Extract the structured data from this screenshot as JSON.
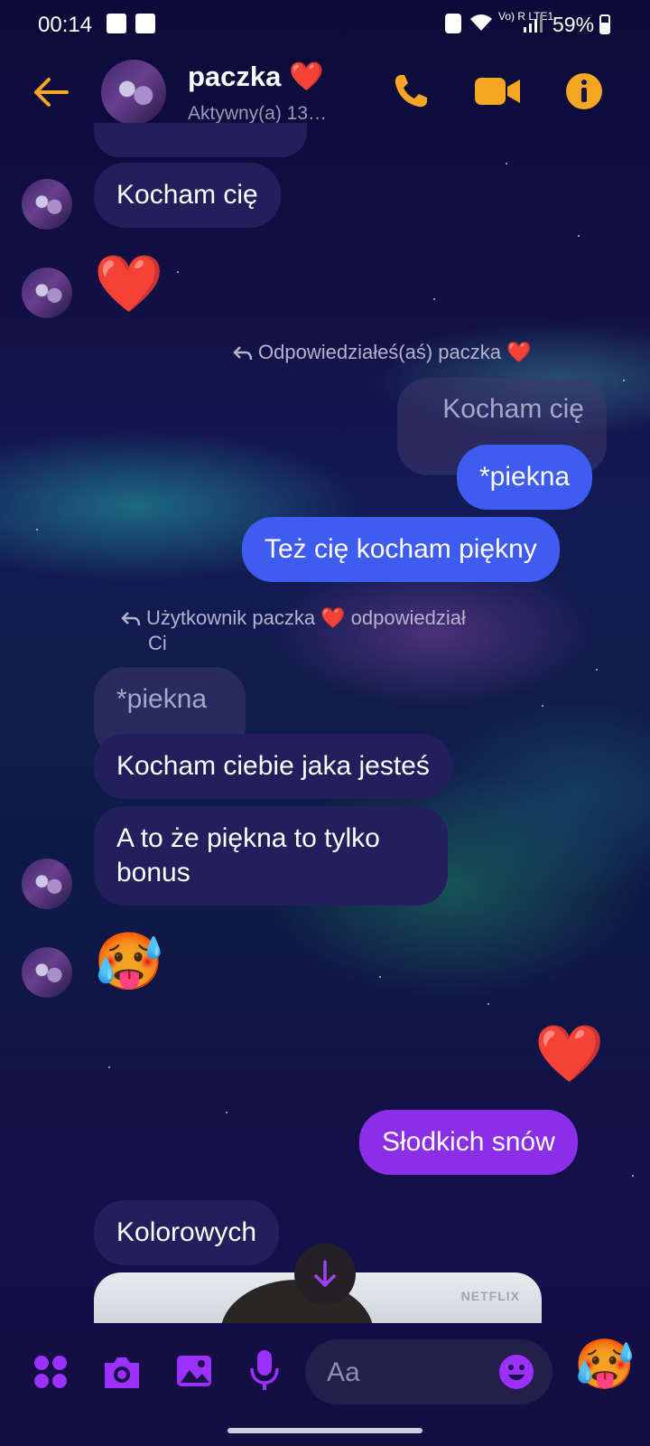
{
  "status_bar": {
    "time": "00:14",
    "battery": "59%",
    "battery_level": 0.59,
    "network": "Vo) R LTE1"
  },
  "header": {
    "name": "paczka",
    "name_emoji": "❤️",
    "status": "Aktywny(a) 13…",
    "icons": [
      "back-arrow-icon",
      "phone-icon",
      "video-camera-icon",
      "info-icon"
    ],
    "accent_color": "#f5a623"
  },
  "messages": [
    {
      "id": "m1",
      "side": "in",
      "text": "Kocham cię"
    },
    {
      "id": "m2",
      "side": "in",
      "type": "emoji",
      "text": "❤️"
    },
    {
      "id": "r1",
      "type": "reply_label",
      "text": "Odpowiedziałeś(aś) paczka ❤️"
    },
    {
      "id": "q1",
      "type": "reply_quote",
      "text": "Kocham cię"
    },
    {
      "id": "m3",
      "side": "out",
      "text": "*piekna"
    },
    {
      "id": "m4",
      "side": "out",
      "text": "Też cię kocham piękny"
    },
    {
      "id": "r2",
      "type": "reply_label",
      "line1": "Użytkownik paczka ❤️ odpowiedział",
      "line2": "Ci"
    },
    {
      "id": "q2",
      "type": "reply_quote",
      "text": "*piekna"
    },
    {
      "id": "m5",
      "side": "in",
      "text": "Kocham ciebie jaka jesteś"
    },
    {
      "id": "m6",
      "side": "in",
      "line1": "A to że piękna to tylko",
      "line2": "bonus"
    },
    {
      "id": "m7",
      "side": "in",
      "type": "emoji",
      "text": "🥵"
    },
    {
      "id": "m8",
      "side": "out",
      "type": "emoji",
      "text": "❤️"
    },
    {
      "id": "m9",
      "side": "out",
      "text": "Słodkich snów"
    },
    {
      "id": "m10",
      "side": "in",
      "text": "Kolorowych"
    }
  ],
  "shared_card": {
    "brand": "NETFLIX"
  },
  "composer": {
    "placeholder": "Aa",
    "quick_reaction": "🥵",
    "icons": [
      "menu-dots-icon",
      "camera-icon",
      "gallery-icon",
      "microphone-icon",
      "emoji-icon"
    ],
    "icon_color": "#9b30ff"
  },
  "colors": {
    "outgoing_blue": "#3f5cf0",
    "outgoing_purple": "#8a2ee8",
    "incoming": "#231f5c"
  }
}
